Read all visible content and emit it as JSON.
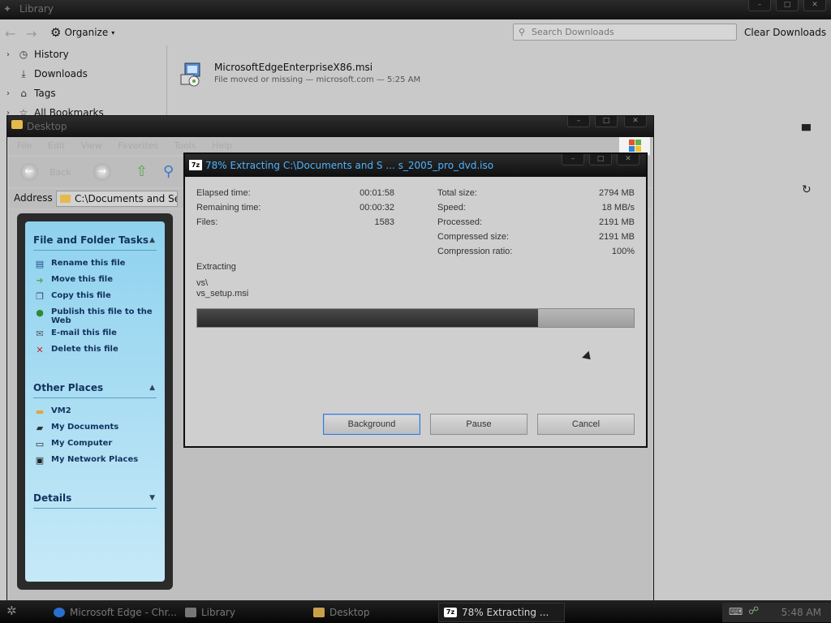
{
  "library": {
    "title": "Library",
    "organize_label": "Organize",
    "search_placeholder": "Search Downloads",
    "clear_label": "Clear Downloads",
    "sidebar": [
      {
        "label": "History",
        "icon": "clock-icon"
      },
      {
        "label": "Downloads",
        "icon": "download-icon"
      },
      {
        "label": "Tags",
        "icon": "tag-icon"
      },
      {
        "label": "All Bookmarks",
        "icon": "star-icon"
      }
    ],
    "download": {
      "name": "MicrosoftEdgeEnterpriseX86.msi",
      "status": "File moved or missing — microsoft.com — 5:25 AM"
    }
  },
  "desktop": {
    "title": "Desktop",
    "back_label": "Back",
    "menu": [
      "File",
      "Edit",
      "View",
      "Favorites",
      "Tools",
      "Help"
    ],
    "address_label": "Address",
    "address_value": "C:\\Documents and Settin",
    "tasks": {
      "file_header": "File and Folder Tasks",
      "file_items": [
        {
          "label": "Rename this file",
          "icon": "rename-icon"
        },
        {
          "label": "Move this file",
          "icon": "move-icon"
        },
        {
          "label": "Copy this file",
          "icon": "copy-icon"
        },
        {
          "label": "Publish this file to the Web",
          "icon": "web-publish-icon"
        },
        {
          "label": "E-mail this file",
          "icon": "email-icon"
        },
        {
          "label": "Delete this file",
          "icon": "delete-icon"
        }
      ],
      "other_header": "Other Places",
      "other_items": [
        {
          "label": "VM2",
          "icon": "folder-icon"
        },
        {
          "label": "My Documents",
          "icon": "documents-icon"
        },
        {
          "label": "My Computer",
          "icon": "computer-icon"
        },
        {
          "label": "My Network Places",
          "icon": "network-icon"
        }
      ],
      "details_header": "Details"
    }
  },
  "extract": {
    "title": "78% Extracting C:\\Documents and S ... s_2005_pro_dvd.iso",
    "left": [
      {
        "label": "Elapsed time:",
        "value": "00:01:58"
      },
      {
        "label": "Remaining time:",
        "value": "00:00:32"
      },
      {
        "label": "Files:",
        "value": "1583"
      }
    ],
    "right": [
      {
        "label": "Total size:",
        "value": "2794 MB"
      },
      {
        "label": "Speed:",
        "value": "18 MB/s"
      },
      {
        "label": "Processed:",
        "value": "2191 MB"
      },
      {
        "label": "Compressed size:",
        "value": "2191 MB"
      },
      {
        "label": "Compression ratio:",
        "value": "100%"
      }
    ],
    "action_label": "Extracting",
    "path_line1": "vs\\",
    "path_line2": "vs_setup.msi",
    "progress_fraction": 0.78,
    "buttons": {
      "background": "Background",
      "pause": "Pause",
      "cancel": "Cancel"
    }
  },
  "taskbar": {
    "items": [
      {
        "label": "Microsoft Edge - Chr...",
        "icon": "edge-icon",
        "active": false
      },
      {
        "label": "Library",
        "icon": "library-icon",
        "active": false
      },
      {
        "label": "Desktop",
        "icon": "folder-icon",
        "active": false
      },
      {
        "label": "78% Extracting ...",
        "icon": "7zip-icon",
        "active": true
      }
    ],
    "clock": "5:48 AM"
  },
  "colors": {
    "title_accent": "#4eb3ff",
    "progress_fill": "#333333",
    "task_pane": "#8fd2ee"
  }
}
